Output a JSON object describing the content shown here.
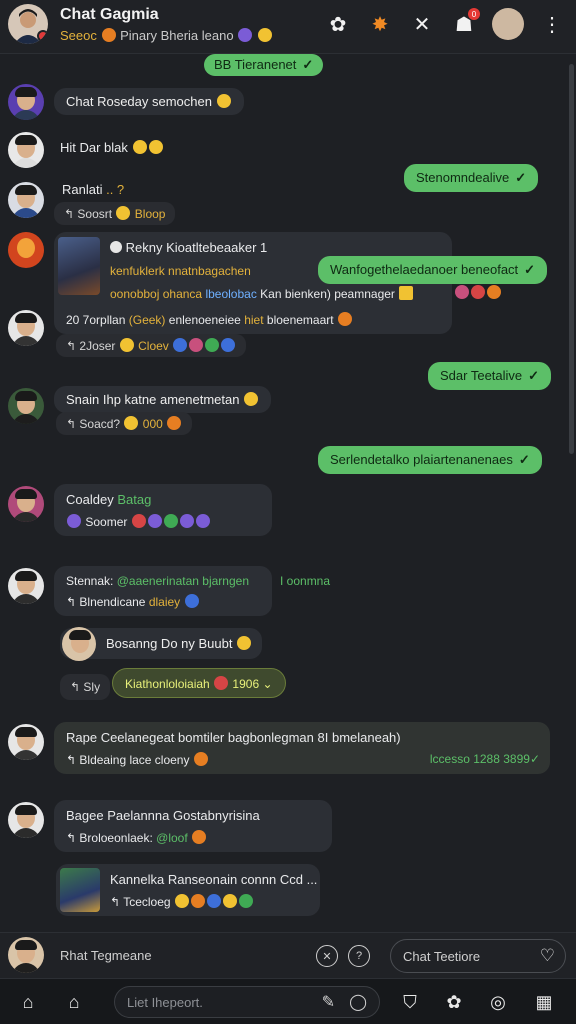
{
  "header": {
    "title": "Chat Gagmia",
    "subtitle_left": "Seeoc",
    "subtitle_right": "Pinary Bheria leano",
    "notification_count": "0"
  },
  "messages": {
    "top_pill": "BB Tieranenet",
    "m1": "Chat Roseday semochen",
    "m2": "Hit Dar blak",
    "out1": "Stenomndealive",
    "m3_name": "Ranlati",
    "m3_sub": "Soosrt",
    "m3_sub2": "Bloop",
    "card_title": "Rekny Kioatltebeaaker 1",
    "card_line1": "kenfuklerk nnatnbagachen",
    "card_line2": "oonobboj ohanca",
    "card_line2b": "lbeolobac",
    "card_line2c": "Kan bienken) peamnager",
    "card_line3": "20 7orpllan",
    "card_line3b": "(Geek)",
    "card_line3c": "enlenoeneiee",
    "card_line3d": "hiet",
    "card_line3e": "bloenemaart",
    "out2": "Wanfogethelaedanoer beneofact",
    "m4_sub": "2Joser",
    "m4_sub2": "Cloev",
    "out3": "Sdar Teetalive",
    "m5": "Snain Ihp katne amenetmetan",
    "m5_sub": "Soacd?",
    "m5_sub2": "000",
    "out4": "Serlendetalko plaiartenanenaes",
    "m6_name": "Coaldey",
    "m6_name2": "Batag",
    "m6_sub": "Soomer",
    "m7_name": "Stennak:",
    "m7_mention": "@aaenerinatan bjarngen",
    "m7_mention2": "I oonmna",
    "m7_sub": "Blnendicane",
    "m7_sub2": "dlaiey",
    "m8": "Bosanng Do ny Buubt",
    "m9_sub": "Sly",
    "m9_pill": "Kiathonloloiaiah",
    "m9_pill_num": "1906",
    "m10": "Rape Ceelanegeat bomtiler bagbonlegman 8I bmelaneah)",
    "m10_sub": "Bldeaing lace cloeny",
    "m10_right": "lccesso 1288 3899",
    "m11": "Bagee Paelannna Gostabnyrisina",
    "m11_sub": "Broloeonlaek:",
    "m11_sub2": "@loof",
    "m12": "Kannelka Ranseonain connn Ccd ...",
    "m12_sub": "Tcecloeg"
  },
  "composer": {
    "label": "Rhat Tegmeane",
    "field": "Chat Teetiore"
  },
  "bottom": {
    "search_placeholder": "Liet Ihepeort."
  }
}
